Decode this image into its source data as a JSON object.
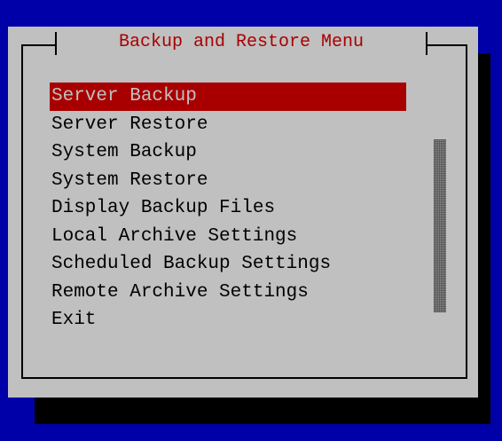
{
  "colors": {
    "desktop": "#0000a8",
    "dialog": "#c0c0c0",
    "shadow": "#000000",
    "title_text": "#a80000",
    "highlight_bg": "#a80000",
    "highlight_text": "#c0c0c0",
    "text": "#000000"
  },
  "dialog": {
    "title": "Backup and Restore Menu",
    "selected_index": 0,
    "items": [
      {
        "label": "Server Backup",
        "selected": true
      },
      {
        "label": "Server Restore",
        "selected": false
      },
      {
        "label": "System Backup",
        "selected": false
      },
      {
        "label": "System Restore",
        "selected": false
      },
      {
        "label": "Display Backup Files",
        "selected": false
      },
      {
        "label": "Local Archive Settings",
        "selected": false
      },
      {
        "label": "Scheduled Backup Settings",
        "selected": false
      },
      {
        "label": "Remote Archive Settings",
        "selected": false
      },
      {
        "label": "Exit",
        "selected": false
      }
    ]
  }
}
